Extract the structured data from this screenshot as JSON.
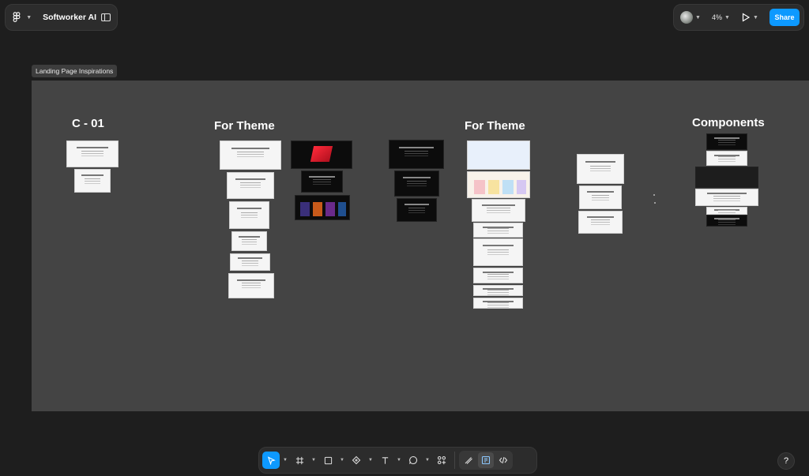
{
  "app": {
    "file_name": "Softworker AI"
  },
  "header": {
    "zoom": "4%",
    "share_label": "Share"
  },
  "canvas": {
    "frame_label": "Landing Page Inspirations",
    "sections": [
      {
        "heading": "C - 01"
      },
      {
        "heading": "For Theme"
      },
      {
        "heading": "For Theme"
      },
      {
        "heading": "Components"
      }
    ]
  },
  "help": {
    "label": "?"
  },
  "icons": {
    "main_menu": "figma-logo-icon",
    "sidebar": "sidebar-toggle-icon",
    "play": "present-play-icon",
    "move": "move-cursor-icon",
    "frame": "frame-hash-icon",
    "rectangle": "rectangle-icon",
    "pen": "pen-icon",
    "text": "text-icon",
    "comment": "comment-icon",
    "actions": "actions-icon",
    "draw": "draw-mode-icon",
    "design": "design-mode-icon",
    "dev": "dev-mode-icon"
  },
  "colors": {
    "accent": "#0d99ff",
    "canvas_bg": "#1e1e1e",
    "frame_bg": "#444444"
  }
}
